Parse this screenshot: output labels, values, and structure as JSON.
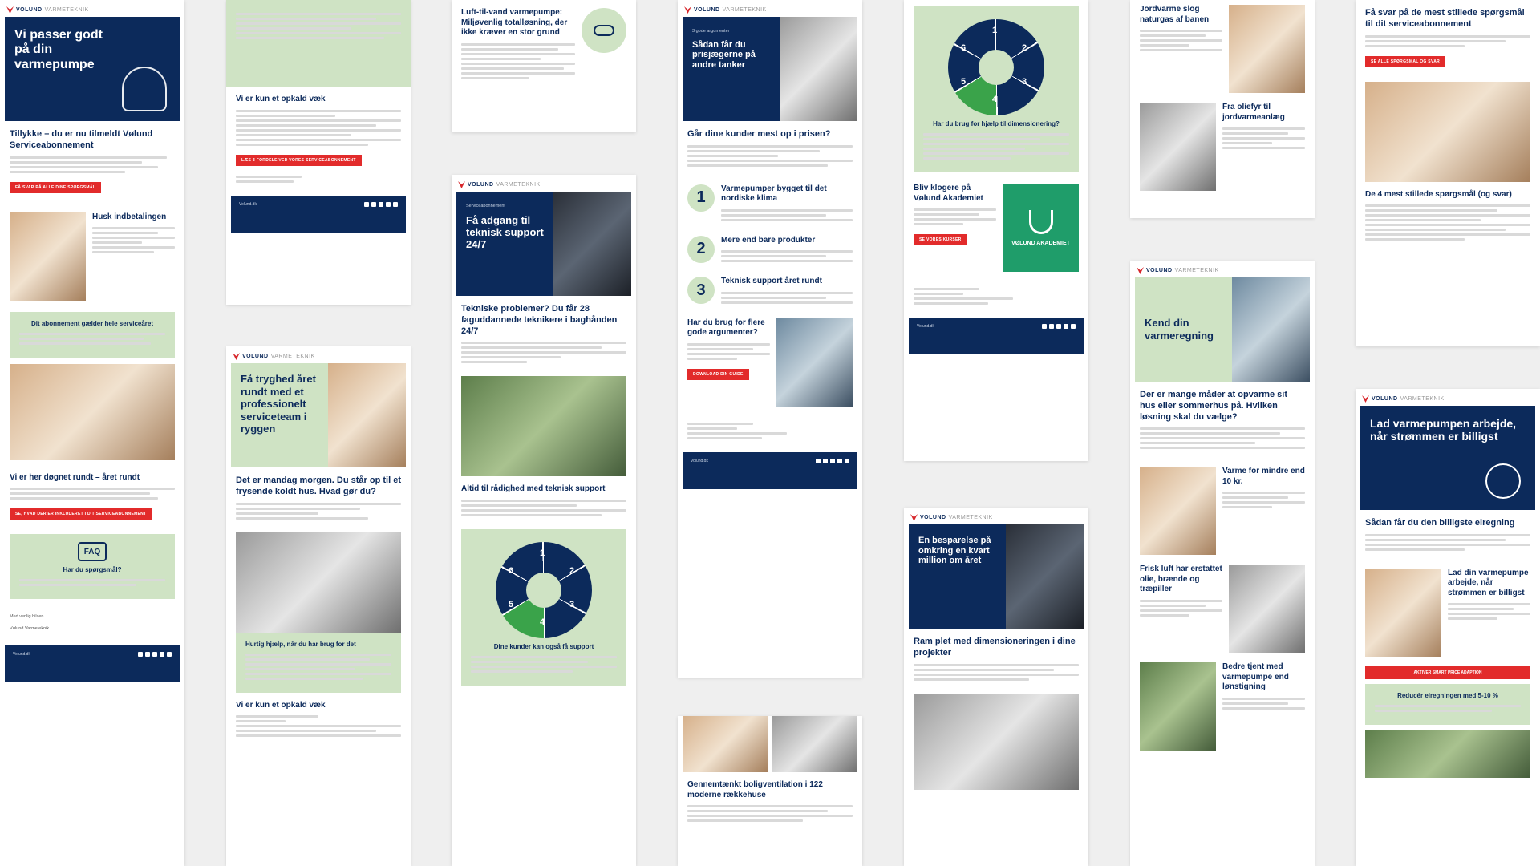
{
  "brand": {
    "name": "VOLUND",
    "sub": "VARMETEKNIK"
  },
  "col1": {
    "hero": "Vi passer godt på din varmepumpe",
    "title": "Tillykke – du er nu tilmeldt Vølund Serviceabonnement",
    "btn1": "FÅ SVAR PÅ ALLE DINE SPØRGSMÅL",
    "sub1": "Husk indbetalingen",
    "green1": "Dit abonnement gælder hele serviceåret",
    "sub2": "Vi er her døgnet rundt – året rundt",
    "btn2": "SE, HVAD DER ER INKLUDERET I DIT SERVICEABONNEMENT",
    "faq": "FAQ",
    "faq_title": "Har du spørgsmål?",
    "sign1": "Med venlig hilsen",
    "sign2": "Vølund Varmeteknik",
    "footer": "Volund.dk"
  },
  "col2": {
    "title1": "Vi er kun et opkald væk",
    "btn1": "LÆS 3 FORDELE VED VORES SERVICEABONNEMENT",
    "hero": "Få tryghed året rundt med et professionelt serviceteam i ryggen",
    "title2": "Det er mandag morgen. Du står op til et frysende koldt hus. Hvad gør du?",
    "green": "Hurtig hjælp, når du har brug for det",
    "title3": "Vi er kun et opkald væk"
  },
  "col3": {
    "title1": "Luft-til-vand varmepumpe: Miljøvenlig totalløsning, der ikke kræver en stor grund",
    "label": "Serviceabonnement",
    "hero": "Få adgang til teknisk support 24/7",
    "title2": "Tekniske problemer? Du får 28 faguddannede teknikere i baghånden 24/7",
    "sub": "Altid til rådighed med teknisk support",
    "green": "Dine kunder kan også få support"
  },
  "col4": {
    "label": "3 gode argumenter",
    "hero": "Sådan får du prisjægerne på andre tanker",
    "title": "Går dine kunder mest op i prisen?",
    "p1": "Varmepumper bygget til det nordiske klima",
    "p2": "Mere end bare produkter",
    "p3": "Teknisk support året rundt",
    "side": "Har du brug for flere gode argumenter?",
    "btn": "DOWNLOAD DIN GUIDE",
    "title2": "Gennemtænkt boligventilation i 122 moderne rækkehuse"
  },
  "col5": {
    "title1": "Har du brug for hjælp til dimensionering?",
    "title2": "Bliv klogere på Vølund Akademiet",
    "btn": "SE VORES KURSER",
    "akademi": "VØLUND AKADEMIET",
    "hero": "En besparelse på omkring en kvart million om året",
    "title3": "Ram plet med dimensioneringen i dine projekter"
  },
  "col6": {
    "t1": "Jordvarme slog naturgas af banen",
    "t2": "Fra oliefyr til jordvarmeanlæg",
    "hero": "Kend din varmeregning",
    "title": "Der er mange måder at opvarme sit hus eller sommerhus på. Hvilken løsning skal du vælge?",
    "t3": "Varme for mindre end 10 kr.",
    "t4": "Frisk luft har erstattet olie, brænde og træpiller",
    "t5": "Bedre tjent med varmepumpe end lønstigning"
  },
  "col7": {
    "title1": "Få svar på de mest stillede spørgsmål til dit serviceabonnement",
    "btn": "SE ALLE SPØRGSMÅL OG SVAR",
    "title2": "De 4 mest stillede spørgsmål (og svar)",
    "hero": "Lad varmepumpen arbejde, når strømmen er billigst",
    "title3": "Sådan får du den billigste elregning",
    "t4": "Lad din varmepumpe arbejde, når strømmen er billigst",
    "btn2": "AKTIVÉR SMART PRICE ADAPTION",
    "green": "Reducér elregningen med 5-10 %"
  }
}
